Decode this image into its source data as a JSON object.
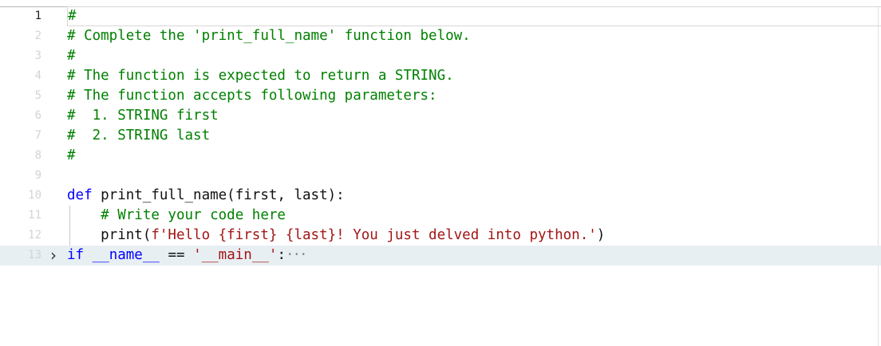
{
  "editor": {
    "lines": [
      {
        "number": "1",
        "text": "#"
      },
      {
        "number": "2",
        "text": "# Complete the 'print_full_name' function below."
      },
      {
        "number": "3",
        "text": "#"
      },
      {
        "number": "4",
        "text": "# The function is expected to return a STRING."
      },
      {
        "number": "5",
        "text": "# The function accepts following parameters:"
      },
      {
        "number": "6",
        "text": "#  1. STRING first"
      },
      {
        "number": "7",
        "text": "#  2. STRING last"
      },
      {
        "number": "8",
        "text": "#"
      },
      {
        "number": "9",
        "text": ""
      },
      {
        "number": "10",
        "def_kw": "def",
        "def_rest": " print_full_name(first, last):"
      },
      {
        "number": "11",
        "text": "    # Write your code here"
      },
      {
        "number": "12",
        "print_fn": "    print(",
        "print_str": "f'Hello {first} {last}! You just delved into python.'",
        "print_close": ")"
      },
      {
        "number": "13",
        "if_kw": "if",
        "if_var": "__name__",
        "if_op": " == ",
        "if_str": "'__main__'",
        "if_colon": ":",
        "ellipsis": "···"
      }
    ],
    "fold_icon": "chevron-right-icon",
    "colors": {
      "comment": "#008000",
      "keyword": "#0000ff",
      "string": "#a31515",
      "folded_line_bg": "#e8eff3"
    }
  }
}
